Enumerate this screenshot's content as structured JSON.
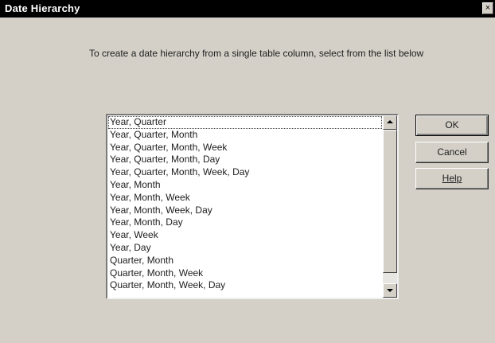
{
  "window": {
    "title": "Date Hierarchy",
    "close_glyph": "×"
  },
  "instructions": "To create a date hierarchy from a single table column, select from the list below",
  "list": {
    "items": [
      "Year, Quarter",
      "Year, Quarter, Month",
      "Year, Quarter, Month, Week",
      "Year, Quarter, Month, Day",
      "Year, Quarter, Month, Week, Day",
      "Year, Month",
      "Year, Month, Week",
      "Year, Month, Week, Day",
      "Year, Month, Day",
      "Year, Week",
      "Year, Day",
      "Quarter, Month",
      "Quarter, Month, Week",
      "Quarter, Month, Week, Day"
    ],
    "selected_index": 0
  },
  "buttons": {
    "ok": "OK",
    "cancel": "Cancel",
    "help": "Help"
  },
  "icons": {
    "close": "close-icon",
    "scroll_up": "arrow-up-icon",
    "scroll_down": "arrow-down-icon"
  }
}
